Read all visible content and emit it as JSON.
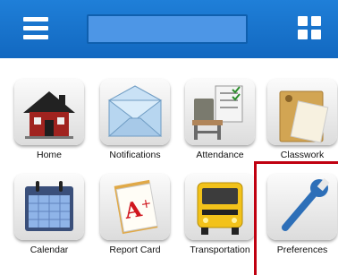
{
  "header": {
    "menu_icon": "hamburger-menu-icon",
    "search_placeholder": "",
    "apps_icon": "grid-apps-icon"
  },
  "tiles": [
    {
      "label": "Home",
      "icon": "home-icon"
    },
    {
      "label": "Notifications",
      "icon": "envelope-icon"
    },
    {
      "label": "Attendance",
      "icon": "attendance-icon"
    },
    {
      "label": "Classwork",
      "icon": "classwork-folder-icon"
    },
    {
      "label": "Calendar",
      "icon": "calendar-icon"
    },
    {
      "label": "Report Card",
      "icon": "report-card-icon"
    },
    {
      "label": "Transportation",
      "icon": "school-bus-icon"
    },
    {
      "label": "Preferences",
      "icon": "wrench-icon"
    }
  ],
  "colors": {
    "header": "#1a74d0",
    "search_field": "#4d96e6",
    "highlight": "#c00010"
  }
}
